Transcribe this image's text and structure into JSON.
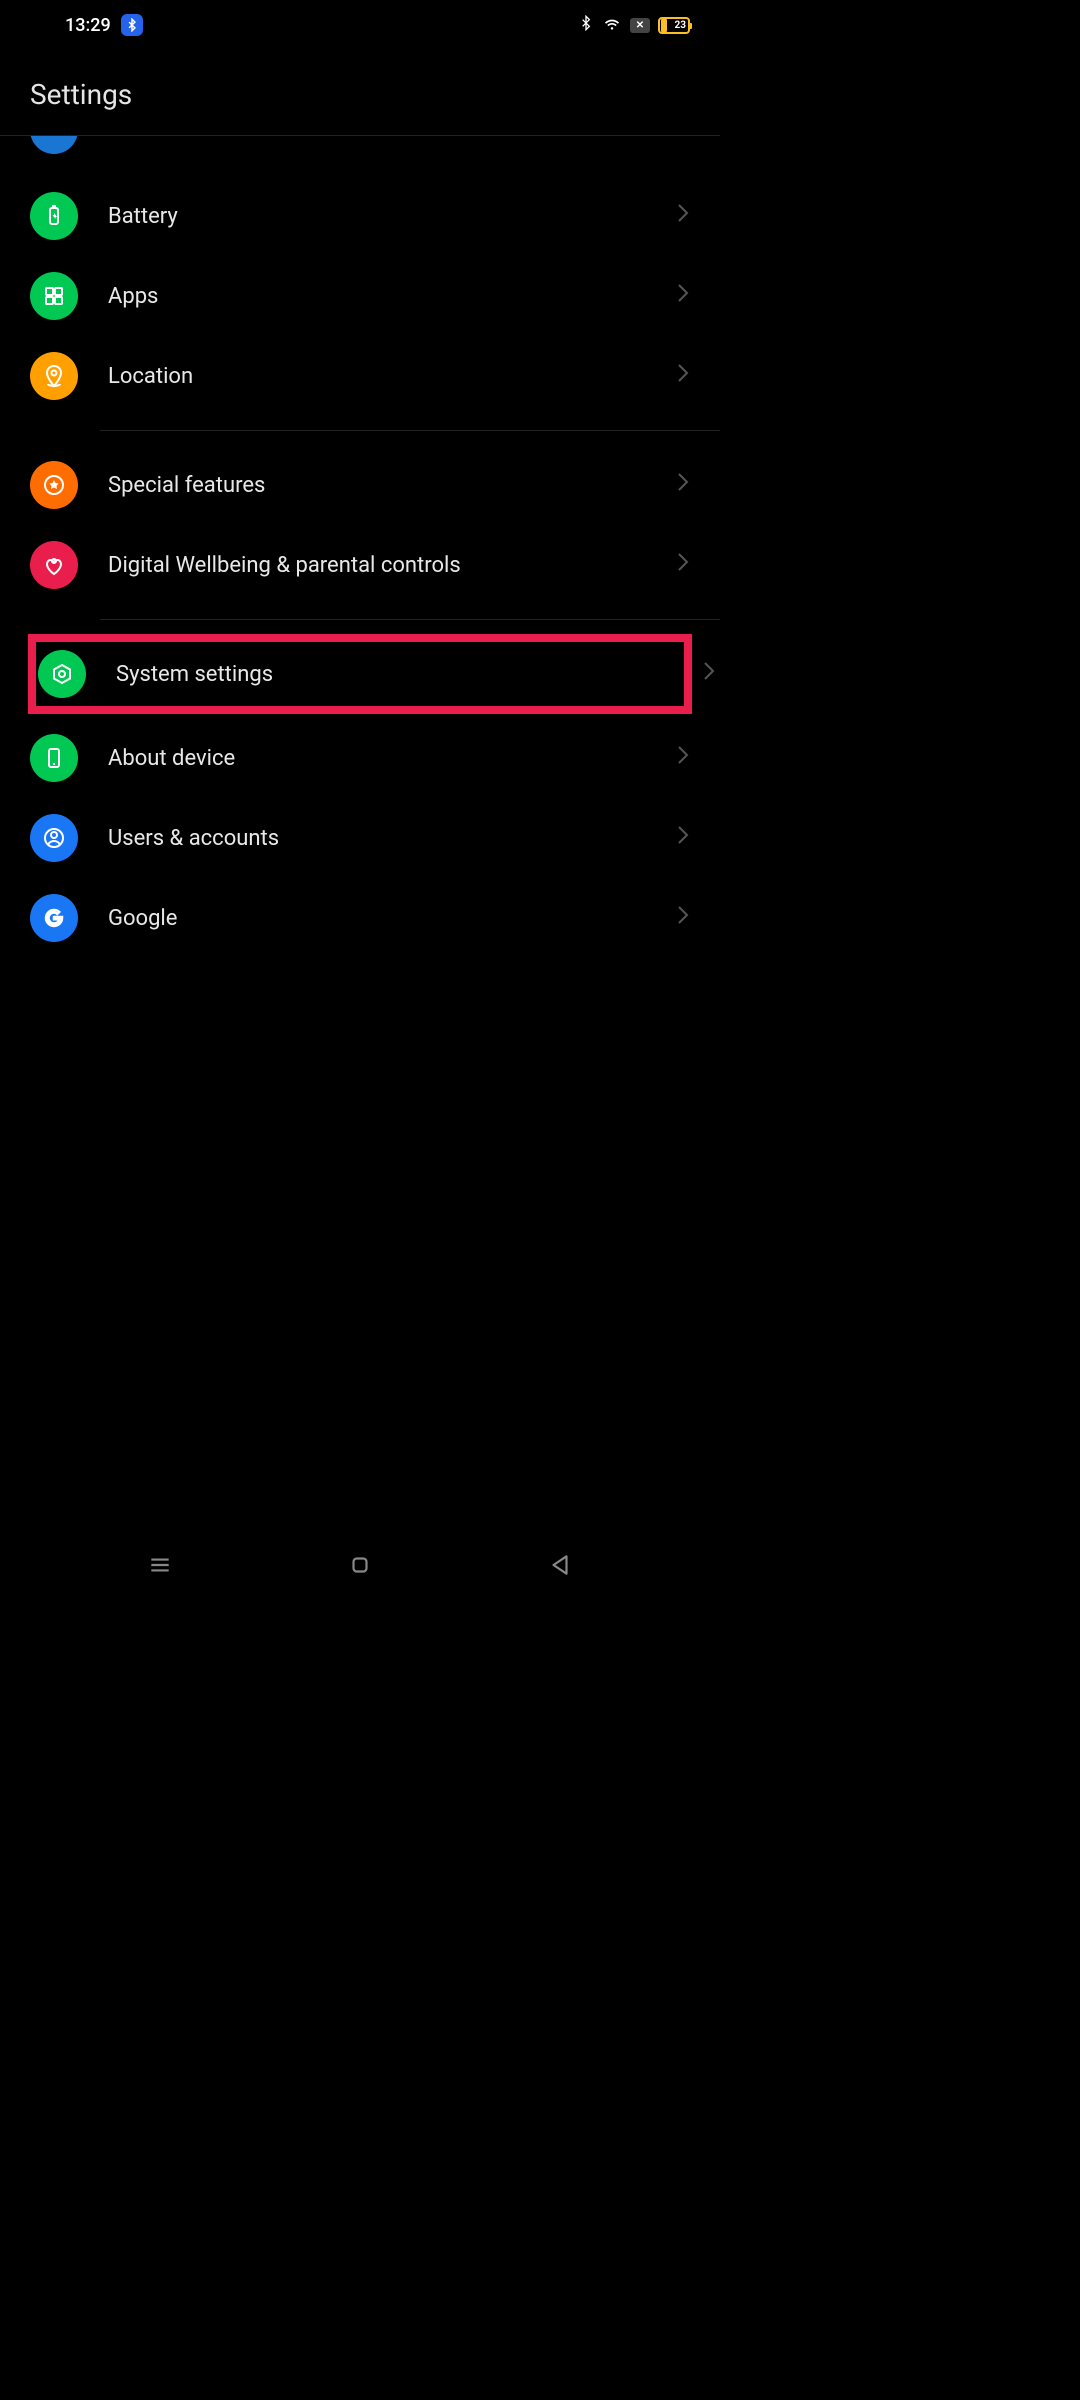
{
  "status": {
    "time": "13:29",
    "battery_percent": "23"
  },
  "header": {
    "title": "Settings"
  },
  "items": [
    {
      "label": "Battery",
      "icon": "battery",
      "color": "green"
    },
    {
      "label": "Apps",
      "icon": "apps",
      "color": "green"
    },
    {
      "label": "Location",
      "icon": "location",
      "color": "amber"
    },
    {
      "label": "Special features",
      "icon": "star-circle",
      "color": "orange"
    },
    {
      "label": "Digital Wellbeing & parental controls",
      "icon": "heart-person",
      "color": "red"
    },
    {
      "label": "System settings",
      "icon": "gear-hex",
      "color": "green",
      "highlighted": true
    },
    {
      "label": "About device",
      "icon": "phone",
      "color": "green"
    },
    {
      "label": "Users & accounts",
      "icon": "user-circle",
      "color": "blue"
    },
    {
      "label": "Google",
      "icon": "google-g",
      "color": "blue"
    }
  ]
}
